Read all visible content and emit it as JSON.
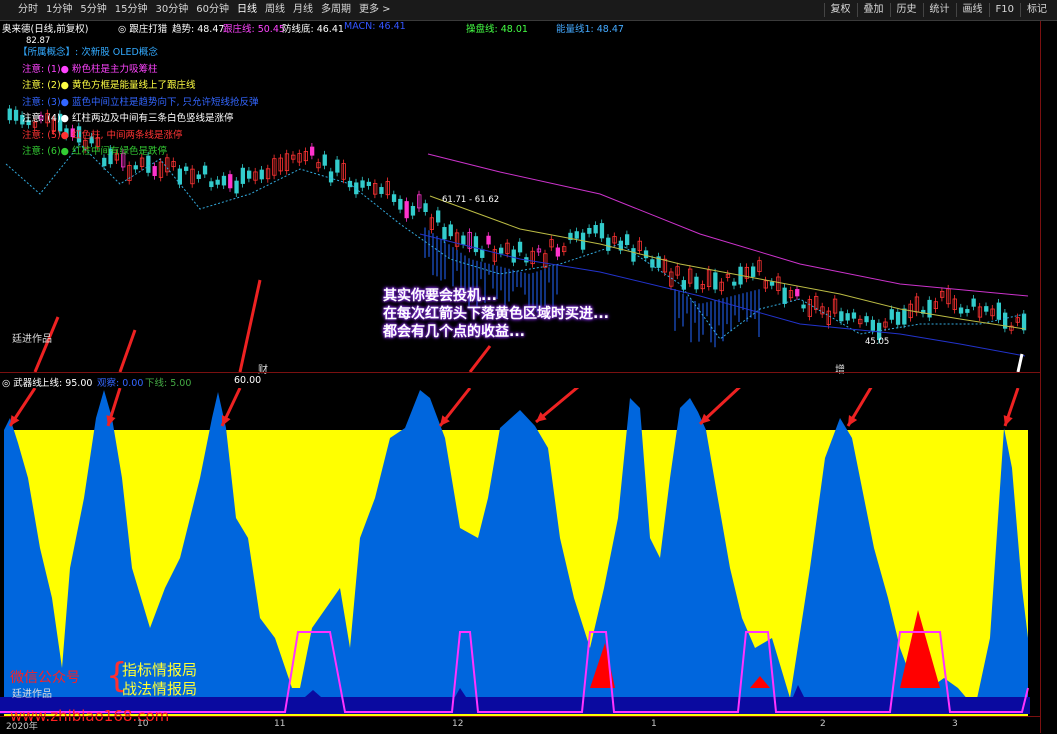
{
  "toolbar": {
    "tabs": [
      "分时",
      "1分钟",
      "5分钟",
      "15分钟",
      "30分钟",
      "60分钟",
      "日线",
      "周线",
      "月线",
      "多周期",
      "更多 >"
    ],
    "active_tab": "日线",
    "right_buttons": [
      "复权",
      "叠加",
      "历史",
      "统计",
      "画线",
      "F10",
      "标记"
    ]
  },
  "price_info": {
    "title": "奥来德(日线,前复权)",
    "indicator": "◎ 跟庄打猎",
    "trend": "趋势: 48.47",
    "follow": "跟庄线: 50.45",
    "follow_bottom": "防线底: 46.41",
    "macn": "MACN: 46.41",
    "operation": "操盘线: 48.01",
    "energy": "能量线1: 48.47"
  },
  "legend_lines": [
    {
      "text": "【所属概念】: 次新股 OLED概念",
      "color": "#33aaff"
    },
    {
      "text": "注意: (1)● 粉色柱是主力吸筹柱",
      "color": "#ff44ff"
    },
    {
      "text": "注意: (2)● 黄色方框是能量线上了跟庄线",
      "color": "#ffff44"
    },
    {
      "text": "注意: (3)● 蓝色中间立柱是趋势向下, 只允许短线抢反弹",
      "color": "#3366ff"
    },
    {
      "text": "注意: (4)● 红柱两边及中间有三条白色竖线是涨停",
      "color": "#ffffff"
    },
    {
      "text": "注意: (5)● 红色柱, 中间两条线是涨停",
      "color": "#ff3333"
    },
    {
      "text": "注意: (6)● 红柱中间有绿色是跌停",
      "color": "#33cc33"
    }
  ],
  "price_labels": {
    "high": "82.87",
    "mid": "61.71 - 61.62",
    "low": "45.05"
  },
  "watermark": "廷进作品",
  "event_labels": {
    "cai": "财",
    "zeng": "增"
  },
  "callout": [
    "其实你要会投机...",
    "在每次红箭头下落黄色区域时买进...",
    "都会有几个点的收益..."
  ],
  "indicator_info": {
    "name": "◎ 武器线",
    "upper": "上线: 95.00",
    "ai": "观察: 0.00",
    "lower": "下线: 5.00",
    "value": "60.00"
  },
  "xaxis": [
    "2020年",
    "10",
    "11",
    "12",
    "1",
    "2",
    "3"
  ],
  "ad": {
    "left": "微信公众号",
    "right1": "指标情报局",
    "right2": "战法情报局",
    "url": "www.zhibiao168.com"
  },
  "colors": {
    "yellow": "#ffff00",
    "blue": "#0066dd",
    "magenta": "#ff33ff",
    "red": "#ff0000",
    "navy": "#0a0aa0"
  }
}
